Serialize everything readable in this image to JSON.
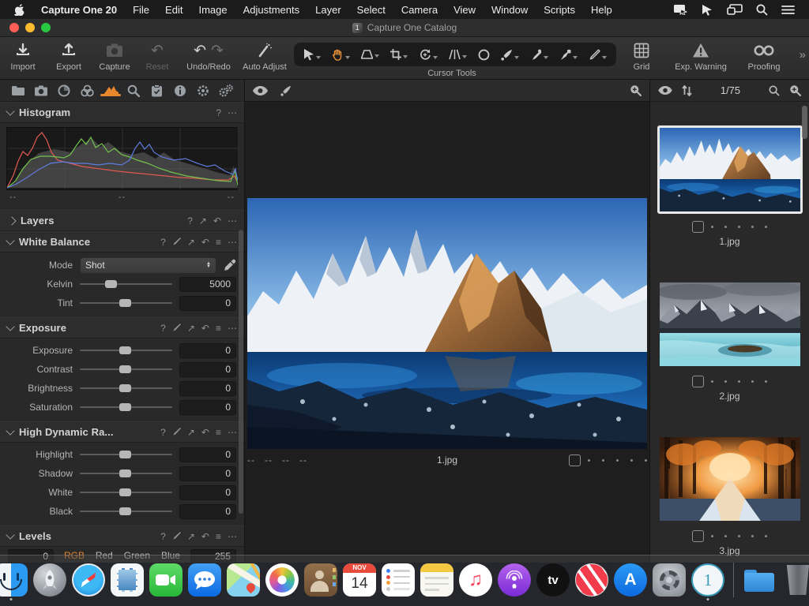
{
  "menubar": {
    "items": [
      "Capture One 20",
      "File",
      "Edit",
      "Image",
      "Adjustments",
      "Layer",
      "Select",
      "Camera",
      "View",
      "Window",
      "Scripts",
      "Help"
    ],
    "status_icons": [
      "screen-mirroring",
      "pointer",
      "displays",
      "search",
      "list"
    ]
  },
  "titlebar": {
    "title": "Capture One Catalog"
  },
  "toolbar": {
    "import": "Import",
    "export": "Export",
    "capture": "Capture",
    "reset": "Reset",
    "undo_redo": "Undo/Redo",
    "auto_adjust": "Auto Adjust",
    "cursor_tools_label": "Cursor Tools",
    "grid": "Grid",
    "exp_warning": "Exp. Warning",
    "proofing": "Proofing",
    "overflow": "»"
  },
  "tools_panel": {
    "histogram": {
      "title": "Histogram",
      "range_labels": [
        "--",
        "--",
        "--"
      ]
    },
    "layers": {
      "title": "Layers"
    },
    "white_balance": {
      "title": "White Balance",
      "mode_label": "Mode",
      "mode_value": "Shot",
      "kelvin_label": "Kelvin",
      "kelvin_value": "5000",
      "tint_label": "Tint",
      "tint_value": "0"
    },
    "exposure": {
      "title": "Exposure",
      "rows": [
        {
          "label": "Exposure",
          "value": "0"
        },
        {
          "label": "Contrast",
          "value": "0"
        },
        {
          "label": "Brightness",
          "value": "0"
        },
        {
          "label": "Saturation",
          "value": "0"
        }
      ]
    },
    "hdr": {
      "title": "High Dynamic Ra...",
      "rows": [
        {
          "label": "Highlight",
          "value": "0"
        },
        {
          "label": "Shadow",
          "value": "0"
        },
        {
          "label": "White",
          "value": "0"
        },
        {
          "label": "Black",
          "value": "0"
        }
      ]
    },
    "levels": {
      "title": "Levels",
      "low": "0",
      "high": "255",
      "channels": [
        "RGB",
        "Red",
        "Green",
        "Blue"
      ],
      "active_channel": "RGB"
    }
  },
  "viewer": {
    "info_marks": [
      "--",
      "--",
      "--",
      "--"
    ],
    "filename": "1.jpg",
    "rating_dots": 5
  },
  "browser": {
    "counter": "1/75",
    "thumbnails": [
      {
        "filename": "1.jpg",
        "selected": true
      },
      {
        "filename": "2.jpg",
        "selected": false
      },
      {
        "filename": "3.jpg",
        "selected": false
      }
    ]
  },
  "dock": {
    "calendar_month": "NOV",
    "calendar_day": "14",
    "tv_label": "tv",
    "appstore_letter": "A",
    "captureone_digit": "1",
    "apps": [
      "finder",
      "launchpad",
      "safari",
      "mail",
      "facetime",
      "messages",
      "maps",
      "photos",
      "contacts",
      "calendar",
      "reminders",
      "notes",
      "music",
      "podcasts",
      "tv",
      "news",
      "appstore",
      "system-preferences",
      "capture-one",
      "folder",
      "trash"
    ]
  },
  "colors": {
    "accent_orange": "#e8872c",
    "selection_white": "#e8e8e8",
    "panel_bg": "#292929",
    "viewer_bg": "#1e1e1e"
  }
}
